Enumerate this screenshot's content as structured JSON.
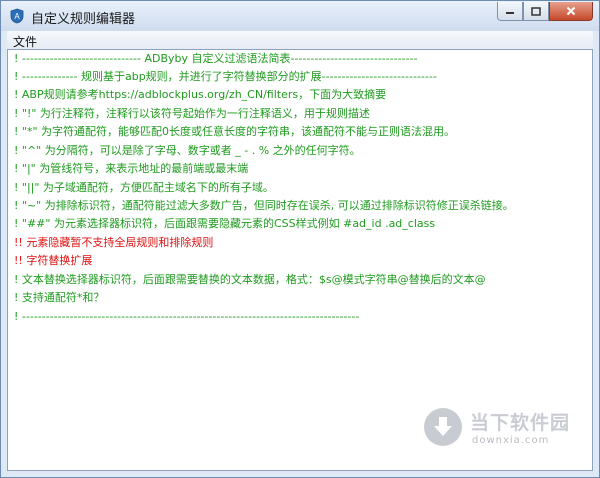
{
  "window": {
    "title": "自定义规则编辑器"
  },
  "menubar": {
    "items": [
      {
        "label": "文件"
      }
    ]
  },
  "editor": {
    "lines": [
      {
        "text": "! ------------------------------ ADByby 自定义过滤语法简表--------------------------------",
        "color": "green"
      },
      {
        "text": "! --------------  规则基于abp规则，并进行了字符替换部分的扩展-----------------------------",
        "color": "green"
      },
      {
        "text": "! ABP规则请参考https://adblockplus.org/zh_CN/filters，下面为大致摘要",
        "color": "green"
      },
      {
        "text": "! \"!\" 为行注释符，注释行以该符号起始作为一行注释语义，用于规则描述",
        "color": "green"
      },
      {
        "text": "! \"*\" 为字符通配符，能够匹配0长度或任意长度的字符串，该通配符不能与正则语法混用。",
        "color": "green"
      },
      {
        "text": "! \"^\" 为分隔符，可以是除了字母、数字或者 _ - . % 之外的任何字符。",
        "color": "green"
      },
      {
        "text": "! \"|\" 为管线符号，来表示地址的最前端或最末端",
        "color": "green"
      },
      {
        "text": "! \"||\" 为子域通配符，方便匹配主域名下的所有子域。",
        "color": "green"
      },
      {
        "text": "! \"~\" 为排除标识符，通配符能过滤大多数广告，但同时存在误杀, 可以通过排除标识符修正误杀链接。",
        "color": "green"
      },
      {
        "text": "! \"##\" 为元素选择器标识符，后面跟需要隐藏元素的CSS样式例如 #ad_id  .ad_class",
        "color": "green"
      },
      {
        "text": "!! 元素隐藏暂不支持全局规则和排除规则",
        "color": "red"
      },
      {
        "text": "!! 字符替换扩展",
        "color": "red"
      },
      {
        "text": "! 文本替换选择器标识符，后面跟需要替换的文本数据，格式：$s@模式字符串@替换后的文本@",
        "color": "green"
      },
      {
        "text": "! 支持通配符*和？",
        "color": "green"
      },
      {
        "text": "! -------------------------------------------------------------------------------------",
        "color": "green"
      }
    ]
  },
  "watermark": {
    "brand": "当下软件园",
    "url": "downxia.com"
  },
  "colors": {
    "comment": "#1f9b1f",
    "highlight": "#e01010"
  }
}
